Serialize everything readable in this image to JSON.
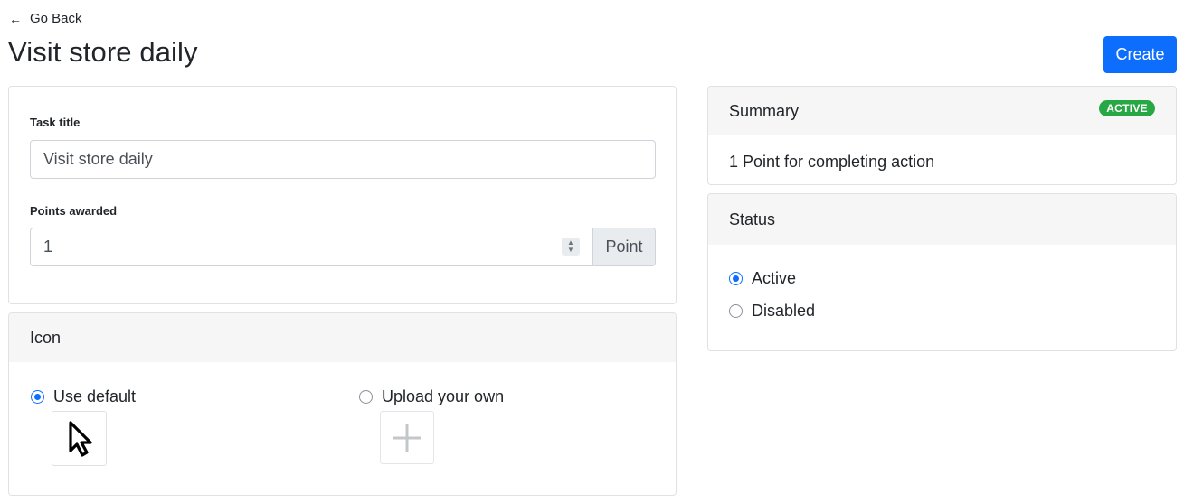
{
  "nav": {
    "back_label": "Go Back",
    "back_icon": "arrow-left-icon"
  },
  "page": {
    "title": "Visit store daily",
    "create_label": "Create"
  },
  "task_card": {
    "title_label": "Task title",
    "title_value": "Visit store daily",
    "points_label": "Points awarded",
    "points_value": "1",
    "points_unit": "Point"
  },
  "icon_card": {
    "header": "Icon",
    "options": [
      {
        "label": "Use default",
        "checked": true
      },
      {
        "label": "Upload your own",
        "checked": false
      }
    ],
    "default_icon": "cursor-pointer-icon",
    "upload_icon": "plus-icon"
  },
  "summary_card": {
    "header": "Summary",
    "badge": "ACTIVE",
    "text": "1 Point for completing action"
  },
  "status_card": {
    "header": "Status",
    "options": [
      {
        "label": "Active",
        "checked": true
      },
      {
        "label": "Disabled",
        "checked": false
      }
    ]
  },
  "colors": {
    "primary": "#0d6efd",
    "success": "#28a745",
    "header_bg": "#f6f6f6"
  }
}
